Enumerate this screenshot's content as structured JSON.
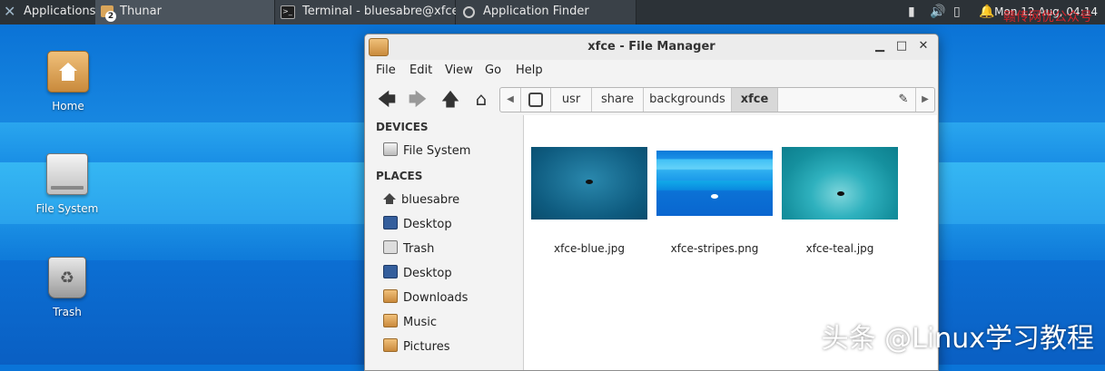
{
  "panel": {
    "applications_label": "Applications",
    "tasks": [
      {
        "label": "Thunar",
        "badge": "2"
      },
      {
        "label": "Terminal - bluesabre@xfce...."
      },
      {
        "label": "Application Finder"
      }
    ],
    "clock": "Mon 12 Aug, 04:14"
  },
  "desktop": {
    "icons": [
      {
        "label": "Home"
      },
      {
        "label": "File System"
      },
      {
        "label": "Trash"
      }
    ]
  },
  "window": {
    "title": "xfce - File Manager",
    "menu": [
      "File",
      "Edit",
      "View",
      "Go",
      "Help"
    ],
    "path": [
      "usr",
      "share",
      "backgrounds",
      "xfce"
    ],
    "sidebar": {
      "devices_header": "DEVICES",
      "devices": [
        {
          "label": "File System"
        }
      ],
      "places_header": "PLACES",
      "places": [
        {
          "label": "bluesabre"
        },
        {
          "label": "Desktop"
        },
        {
          "label": "Trash"
        },
        {
          "label": "Desktop"
        },
        {
          "label": "Downloads"
        },
        {
          "label": "Music"
        },
        {
          "label": "Pictures"
        }
      ]
    },
    "files": [
      {
        "name": "xfce-blue.jpg"
      },
      {
        "name": "xfce-stripes.png"
      },
      {
        "name": "xfce-teal.jpg"
      }
    ]
  },
  "watermark": "头条 @Linux学习教程",
  "site_mark": "赣传网优公众号"
}
